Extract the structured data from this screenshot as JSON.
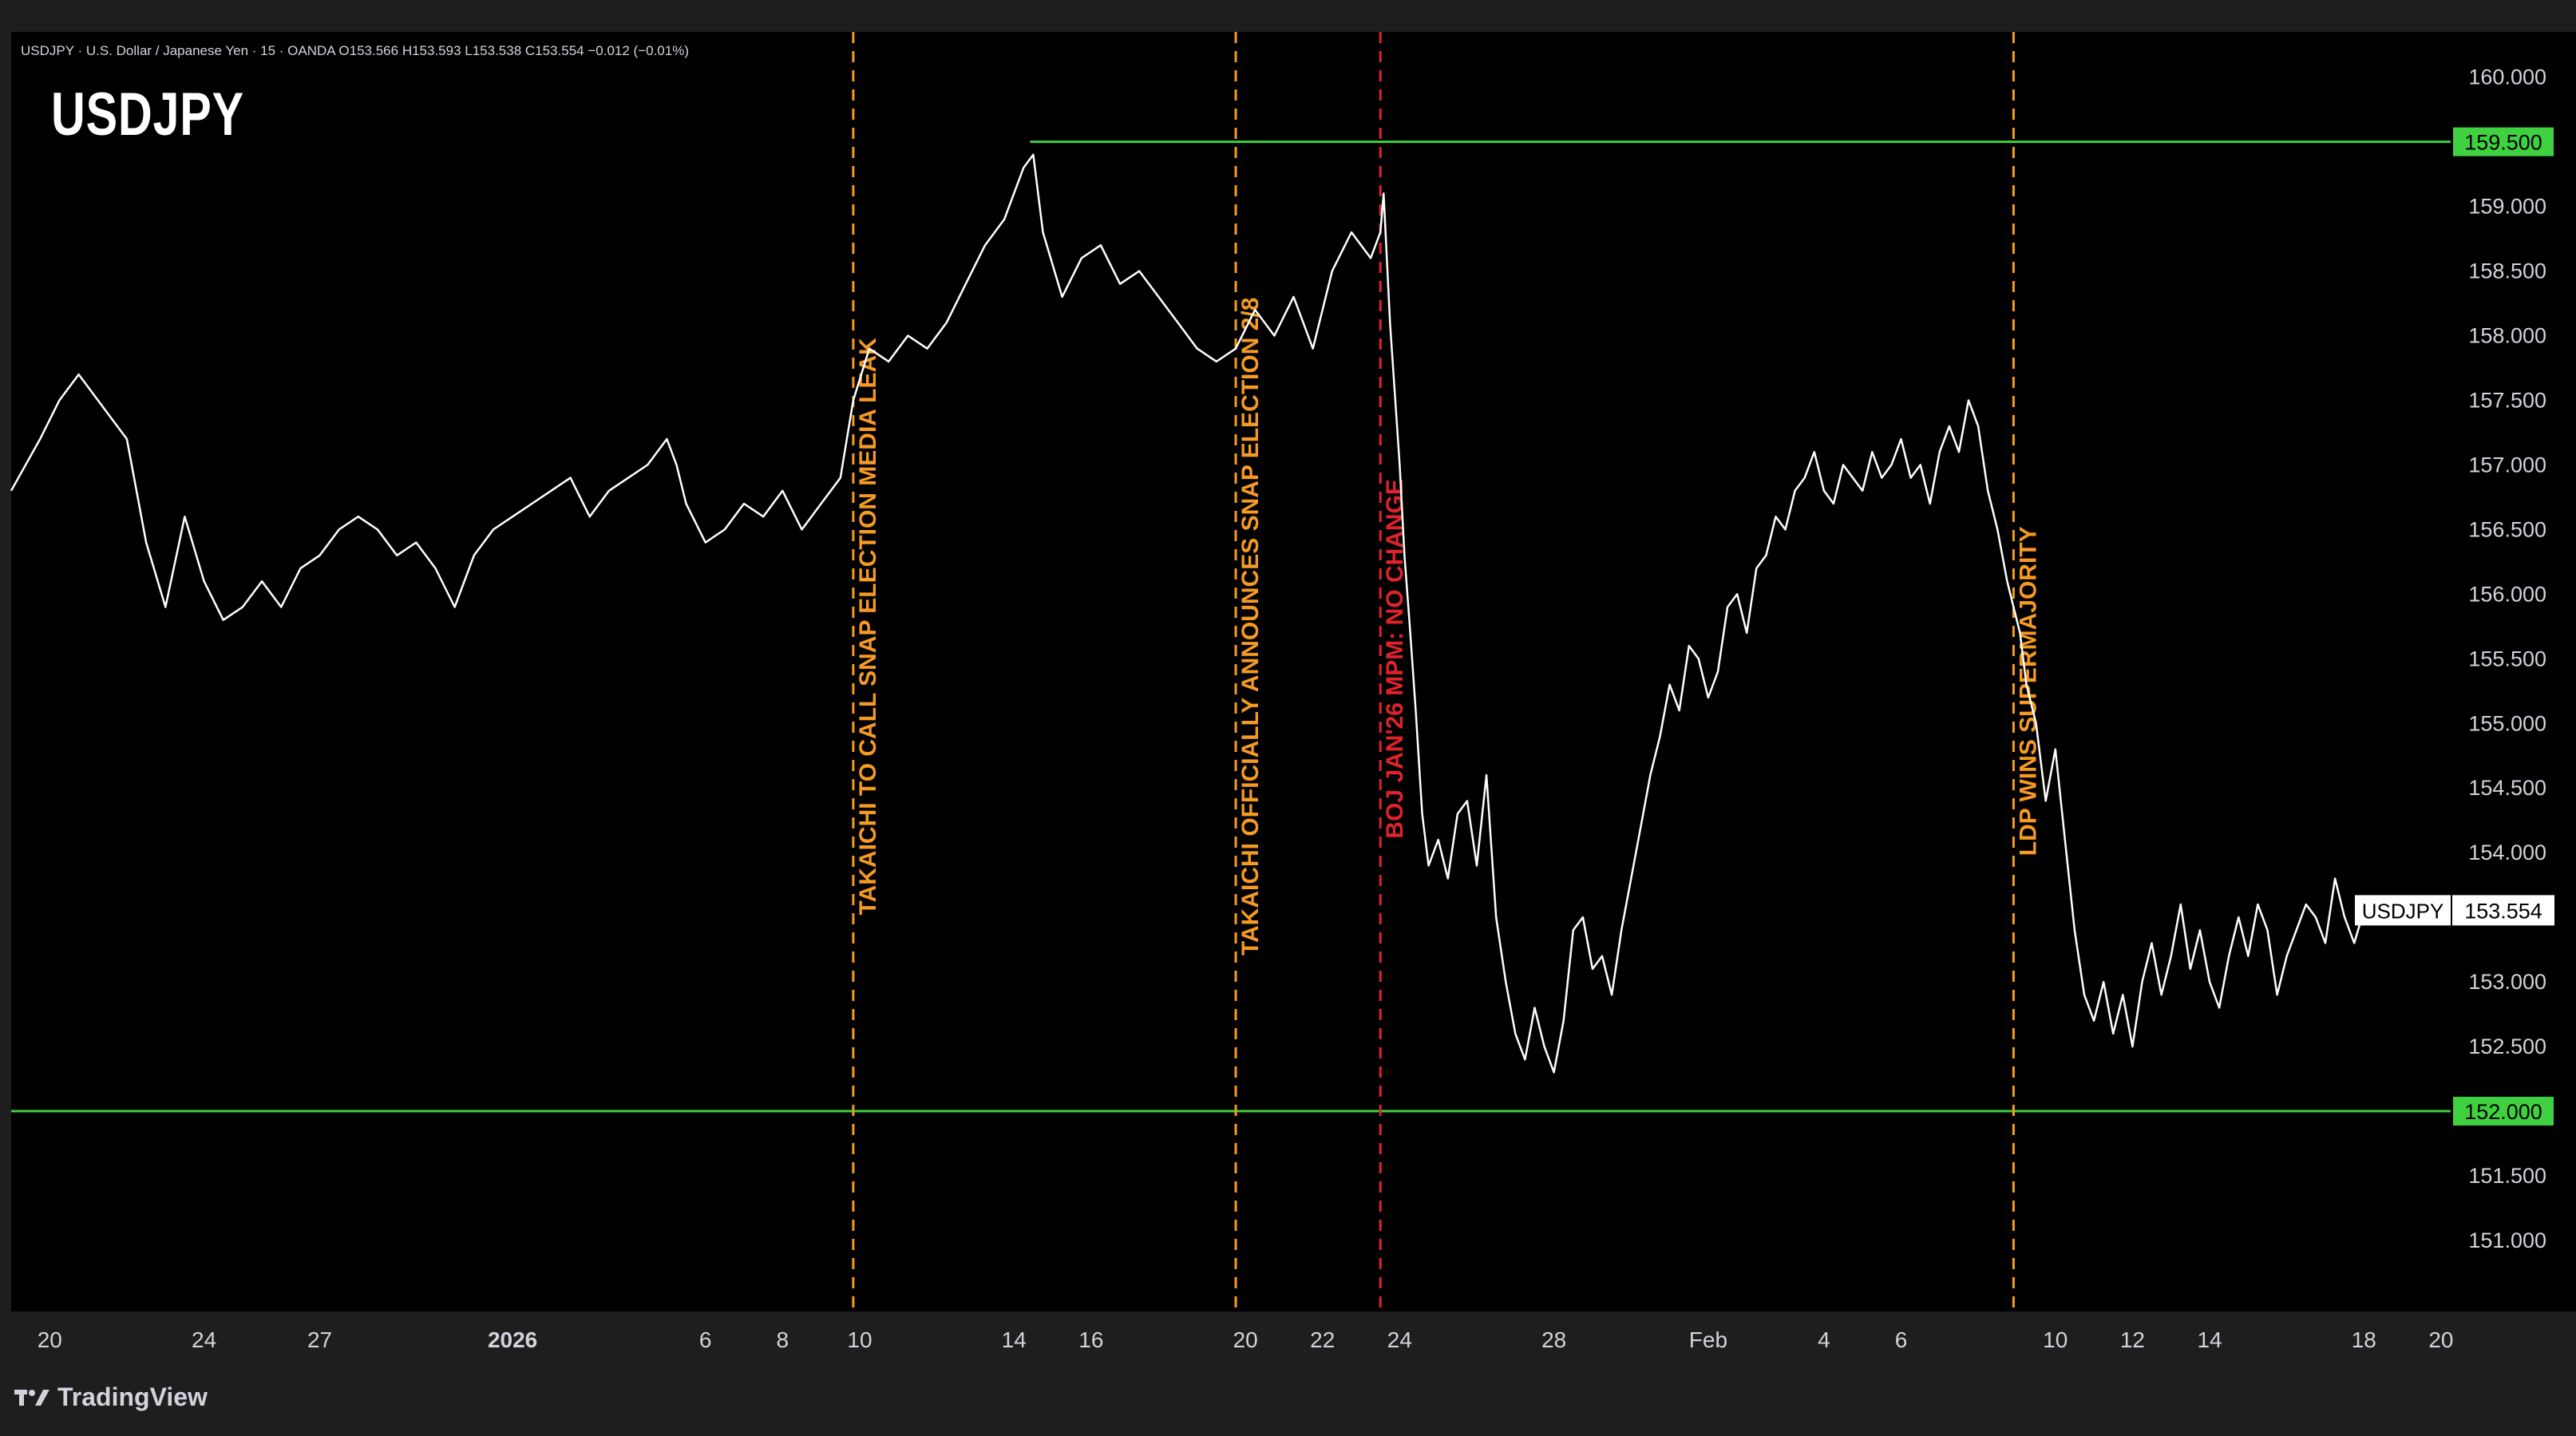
{
  "header": {
    "legend_text": "USDJPY · U.S. Dollar / Japanese Yen · 15 · OANDA  O153.566  H153.593  L153.538  C153.554  −0.012 (−0.01%)",
    "title": "USDJPY"
  },
  "footer": {
    "brand": "TradingView"
  },
  "colors": {
    "background": "#000000",
    "frame": "#1e1e1e",
    "price_line": "#ffffff",
    "level_line": "#3fd13f",
    "orange_event": "#f59a23",
    "red_event": "#e0232a",
    "axis_text": "#d1d4dc"
  },
  "chart_data": {
    "type": "line",
    "title": "USDJPY",
    "symbol": "USDJPY",
    "timeframe": "15",
    "source": "OANDA",
    "ohlc": {
      "open": 153.566,
      "high": 153.593,
      "low": 153.538,
      "close": 153.554,
      "change": -0.012,
      "change_pct": -0.01
    },
    "ylim": [
      150.45,
      160.35
    ],
    "y_ticks": [
      "160.000",
      "159.000",
      "158.500",
      "158.000",
      "157.500",
      "157.000",
      "156.500",
      "156.000",
      "155.500",
      "155.000",
      "154.500",
      "154.000",
      "153.000",
      "152.500",
      "151.500",
      "151.000"
    ],
    "x_ticks": [
      {
        "label": "20",
        "date": "2025-12-20"
      },
      {
        "label": "24",
        "date": "2025-12-24"
      },
      {
        "label": "27",
        "date": "2025-12-27"
      },
      {
        "label": "2026",
        "date": "2026-01-01",
        "bold": true
      },
      {
        "label": "6",
        "date": "2026-01-06"
      },
      {
        "label": "8",
        "date": "2026-01-08"
      },
      {
        "label": "10",
        "date": "2026-01-10"
      },
      {
        "label": "14",
        "date": "2026-01-14"
      },
      {
        "label": "16",
        "date": "2026-01-16"
      },
      {
        "label": "20",
        "date": "2026-01-20"
      },
      {
        "label": "22",
        "date": "2026-01-22"
      },
      {
        "label": "24",
        "date": "2026-01-24"
      },
      {
        "label": "28",
        "date": "2026-01-28"
      },
      {
        "label": "Feb",
        "date": "2026-02-01"
      },
      {
        "label": "4",
        "date": "2026-02-04"
      },
      {
        "label": "6",
        "date": "2026-02-06"
      },
      {
        "label": "10",
        "date": "2026-02-10"
      },
      {
        "label": "12",
        "date": "2026-02-12"
      },
      {
        "label": "14",
        "date": "2026-02-14"
      },
      {
        "label": "18",
        "date": "2026-02-18"
      },
      {
        "label": "20",
        "date": "2026-02-20"
      }
    ],
    "horizontal_levels": [
      {
        "price": 159.5,
        "label": "159.500",
        "from_date": "2026-01-14T10:00"
      },
      {
        "price": 152.0,
        "label": "152.000",
        "from_date": "2025-12-19T00:00"
      }
    ],
    "events": [
      {
        "date": "2026-01-09T20:00",
        "label": "TAKAICHI TO CALL SNAP ELECTION MEDIA LEAK",
        "color": "orange",
        "label_price": 155.75
      },
      {
        "date": "2026-01-19T18:00",
        "label": "TAKAICHI OFFICIALLY ANNOUNCES  SNAP ELECTION 2/8",
        "color": "orange",
        "label_price": 155.75
      },
      {
        "date": "2026-01-23T12:00",
        "label": "BOJ JAN'26 MPM: NO CHANGE",
        "color": "red",
        "label_price": 155.5
      },
      {
        "date": "2026-02-08T22:00",
        "label": "LDP WINS SUPERMAJORITY",
        "color": "orange",
        "label_price": 155.25
      }
    ],
    "last_price": {
      "symbol": "USDJPY",
      "price": 153.554,
      "label": "153.554"
    },
    "x": [
      "2025-12-19T00:00",
      "2025-12-19T18:00",
      "2025-12-20T06:00",
      "2025-12-20T18:00",
      "2025-12-21T12:00",
      "2025-12-22T00:00",
      "2025-12-22T12:00",
      "2025-12-23T00:00",
      "2025-12-23T12:00",
      "2025-12-24T00:00",
      "2025-12-24T12:00",
      "2025-12-25T00:00",
      "2025-12-25T12:00",
      "2025-12-26T00:00",
      "2025-12-26T12:00",
      "2025-12-27T00:00",
      "2025-12-27T12:00",
      "2025-12-28T00:00",
      "2025-12-28T12:00",
      "2025-12-29T00:00",
      "2025-12-29T12:00",
      "2025-12-30T00:00",
      "2025-12-30T12:00",
      "2025-12-31T00:00",
      "2025-12-31T12:00",
      "2026-01-01T00:00",
      "2026-01-01T12:00",
      "2026-01-02T00:00",
      "2026-01-02T12:00",
      "2026-01-03T00:00",
      "2026-01-03T12:00",
      "2026-01-04T00:00",
      "2026-01-04T12:00",
      "2026-01-05T00:00",
      "2026-01-05T06:00",
      "2026-01-05T12:00",
      "2026-01-06T00:00",
      "2026-01-06T12:00",
      "2026-01-07T00:00",
      "2026-01-07T12:00",
      "2026-01-08T00:00",
      "2026-01-08T12:00",
      "2026-01-09T00:00",
      "2026-01-09T12:00",
      "2026-01-09T20:00",
      "2026-01-10T06:00",
      "2026-01-10T18:00",
      "2026-01-11T06:00",
      "2026-01-11T18:00",
      "2026-01-12T06:00",
      "2026-01-12T18:00",
      "2026-01-13T06:00",
      "2026-01-13T18:00",
      "2026-01-14T06:00",
      "2026-01-14T12:00",
      "2026-01-14T18:00",
      "2026-01-15T06:00",
      "2026-01-15T18:00",
      "2026-01-16T06:00",
      "2026-01-16T18:00",
      "2026-01-17T06:00",
      "2026-01-17T18:00",
      "2026-01-18T06:00",
      "2026-01-18T18:00",
      "2026-01-19T06:00",
      "2026-01-19T18:00",
      "2026-01-20T06:00",
      "2026-01-20T18:00",
      "2026-01-21T06:00",
      "2026-01-21T18:00",
      "2026-01-22T06:00",
      "2026-01-22T18:00",
      "2026-01-23T06:00",
      "2026-01-23T12:00",
      "2026-01-23T14:00",
      "2026-01-23T18:00",
      "2026-01-24T00:00",
      "2026-01-24T03:00",
      "2026-01-24T06:00",
      "2026-01-24T10:00",
      "2026-01-24T14:00",
      "2026-01-24T18:00",
      "2026-01-25T00:00",
      "2026-01-25T06:00",
      "2026-01-25T12:00",
      "2026-01-25T18:00",
      "2026-01-26T00:00",
      "2026-01-26T06:00",
      "2026-01-26T12:00",
      "2026-01-26T18:00",
      "2026-01-27T00:00",
      "2026-01-27T06:00",
      "2026-01-27T12:00",
      "2026-01-27T18:00",
      "2026-01-28T00:00",
      "2026-01-28T06:00",
      "2026-01-28T12:00",
      "2026-01-28T18:00",
      "2026-01-29T00:00",
      "2026-01-29T06:00",
      "2026-01-29T12:00",
      "2026-01-29T18:00",
      "2026-01-30T00:00",
      "2026-01-30T06:00",
      "2026-01-30T12:00",
      "2026-01-30T18:00",
      "2026-01-31T00:00",
      "2026-01-31T06:00",
      "2026-01-31T12:00",
      "2026-01-31T18:00",
      "2026-02-01T00:00",
      "2026-02-01T06:00",
      "2026-02-01T12:00",
      "2026-02-01T18:00",
      "2026-02-02T00:00",
      "2026-02-02T06:00",
      "2026-02-02T12:00",
      "2026-02-02T18:00",
      "2026-02-03T00:00",
      "2026-02-03T06:00",
      "2026-02-03T12:00",
      "2026-02-03T18:00",
      "2026-02-04T00:00",
      "2026-02-04T06:00",
      "2026-02-04T12:00",
      "2026-02-04T18:00",
      "2026-02-05T00:00",
      "2026-02-05T06:00",
      "2026-02-05T12:00",
      "2026-02-05T18:00",
      "2026-02-06T00:00",
      "2026-02-06T06:00",
      "2026-02-06T12:00",
      "2026-02-06T18:00",
      "2026-02-07T00:00",
      "2026-02-07T06:00",
      "2026-02-07T12:00",
      "2026-02-07T18:00",
      "2026-02-08T00:00",
      "2026-02-08T06:00",
      "2026-02-08T12:00",
      "2026-02-08T18:00",
      "2026-02-08T22:00",
      "2026-02-09T02:00",
      "2026-02-09T06:00",
      "2026-02-09T12:00",
      "2026-02-09T18:00",
      "2026-02-10T00:00",
      "2026-02-10T06:00",
      "2026-02-10T12:00",
      "2026-02-10T18:00",
      "2026-02-11T00:00",
      "2026-02-11T06:00",
      "2026-02-11T12:00",
      "2026-02-11T18:00",
      "2026-02-12T00:00",
      "2026-02-12T06:00",
      "2026-02-12T12:00",
      "2026-02-12T18:00",
      "2026-02-13T00:00",
      "2026-02-13T06:00",
      "2026-02-13T12:00",
      "2026-02-13T18:00",
      "2026-02-14T00:00",
      "2026-02-14T06:00",
      "2026-02-14T12:00",
      "2026-02-14T18:00",
      "2026-02-15T00:00",
      "2026-02-15T06:00",
      "2026-02-15T12:00",
      "2026-02-15T18:00",
      "2026-02-16T00:00",
      "2026-02-16T06:00",
      "2026-02-16T12:00",
      "2026-02-16T18:00",
      "2026-02-17T00:00",
      "2026-02-17T06:00",
      "2026-02-17T12:00",
      "2026-02-17T18:00",
      "2026-02-18T00:00",
      "2026-02-18T06:00",
      "2026-02-18T12:00"
    ],
    "values": [
      156.8,
      157.2,
      157.5,
      157.7,
      157.4,
      157.2,
      156.4,
      155.9,
      156.6,
      156.1,
      155.8,
      155.9,
      156.1,
      155.9,
      156.2,
      156.3,
      156.5,
      156.6,
      156.5,
      156.3,
      156.4,
      156.2,
      155.9,
      156.3,
      156.5,
      156.6,
      156.7,
      156.8,
      156.9,
      156.6,
      156.8,
      156.9,
      157.0,
      157.2,
      157.0,
      156.7,
      156.4,
      156.5,
      156.7,
      156.6,
      156.8,
      156.5,
      156.7,
      156.9,
      157.5,
      157.9,
      157.8,
      158.0,
      157.9,
      158.1,
      158.4,
      158.7,
      158.9,
      159.3,
      159.4,
      158.8,
      158.3,
      158.6,
      158.7,
      158.4,
      158.5,
      158.3,
      158.1,
      157.9,
      157.8,
      157.9,
      158.2,
      158.0,
      158.3,
      157.9,
      158.5,
      158.8,
      158.6,
      158.8,
      159.1,
      158.1,
      157.0,
      156.3,
      155.8,
      155.1,
      154.3,
      153.9,
      154.1,
      153.8,
      154.3,
      154.4,
      153.9,
      154.6,
      153.5,
      153.0,
      152.6,
      152.4,
      152.8,
      152.5,
      152.3,
      152.7,
      153.4,
      153.5,
      153.1,
      153.2,
      152.9,
      153.4,
      153.8,
      154.2,
      154.6,
      154.9,
      155.3,
      155.1,
      155.6,
      155.5,
      155.2,
      155.4,
      155.9,
      156.0,
      155.7,
      156.2,
      156.3,
      156.6,
      156.5,
      156.8,
      156.9,
      157.1,
      156.8,
      156.7,
      157.0,
      156.9,
      156.8,
      157.1,
      156.9,
      157.0,
      157.2,
      156.9,
      157.0,
      156.7,
      157.1,
      157.3,
      157.1,
      157.5,
      157.3,
      156.8,
      156.5,
      156.1,
      155.9,
      155.7,
      155.3,
      155.0,
      154.4,
      154.8,
      154.1,
      153.4,
      152.9,
      152.7,
      153.0,
      152.6,
      152.9,
      152.5,
      153.0,
      153.3,
      152.9,
      153.2,
      153.6,
      153.1,
      153.4,
      153.0,
      152.8,
      153.2,
      153.5,
      153.2,
      153.6,
      153.4,
      152.9,
      153.2,
      153.4,
      153.6,
      153.5,
      153.3,
      153.8,
      153.5,
      153.3,
      153.554
    ]
  }
}
